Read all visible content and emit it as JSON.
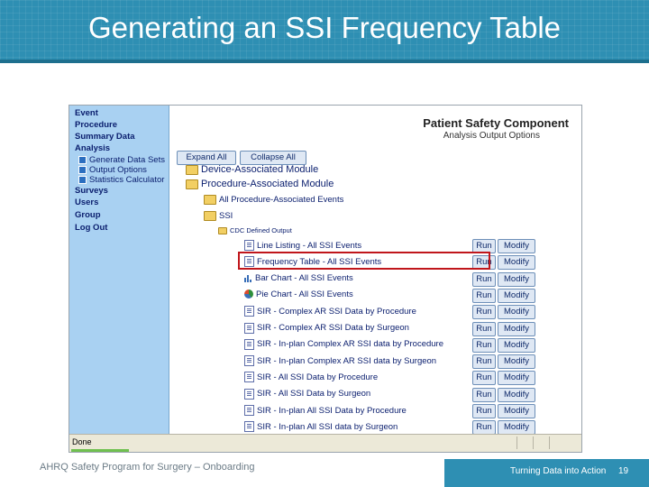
{
  "slide": {
    "title": "Generating an SSI Frequency Table",
    "footer_left": "AHRQ Safety Program for Surgery – Onboarding",
    "footer_right": "Turning Data into Action",
    "page_number": "19"
  },
  "nav": {
    "items": [
      "Event",
      "Procedure",
      "Summary Data",
      "Analysis"
    ],
    "analysis_sub": [
      "Generate Data Sets",
      "Output Options",
      "Statistics Calculator"
    ],
    "items_after": [
      "Surveys",
      "Users",
      "Group",
      "Log Out"
    ]
  },
  "component": {
    "title": "Patient Safety Component",
    "subtitle": "Analysis Output Options"
  },
  "tree": {
    "expand_all": "Expand All",
    "collapse_all": "Collapse All",
    "device_module": "Device-Associated Module",
    "procedure_module": "Procedure-Associated Module",
    "all_procedure_events": "All Procedure-Associated Events",
    "ssi": "SSI",
    "cdc_defined": "CDC Defined Output"
  },
  "rows": [
    {
      "label": "Line Listing - All SSI Events",
      "icon": "report-icon"
    },
    {
      "label": "Frequency Table - All SSI Events",
      "icon": "report-icon"
    },
    {
      "label": "Bar Chart - All SSI Events",
      "icon": "bar-chart-icon"
    },
    {
      "label": "Pie Chart - All SSI Events",
      "icon": "pie-chart-icon"
    },
    {
      "label": "SIR - Complex AR SSI Data by Procedure",
      "icon": "report-icon"
    },
    {
      "label": "SIR - Complex AR SSI Data by Surgeon",
      "icon": "report-icon"
    },
    {
      "label": "SIR - In-plan Complex AR SSI data by Procedure",
      "icon": "report-icon"
    },
    {
      "label": "SIR - In-plan Complex AR SSI data by Surgeon",
      "icon": "report-icon"
    },
    {
      "label": "SIR - All SSI Data by Procedure",
      "icon": "report-icon"
    },
    {
      "label": "SIR - All SSI Data by Surgeon",
      "icon": "report-icon"
    },
    {
      "label": "SIR - In-plan All SSI Data by Procedure",
      "icon": "report-icon"
    },
    {
      "label": "SIR - In-plan All SSI data by Surgeon",
      "icon": "report-icon"
    }
  ],
  "row_buttons": {
    "run": "Run",
    "modify": "Modify"
  },
  "status": {
    "text": "Done"
  },
  "colors": {
    "header": "#2e8fb3",
    "highlight": "#c0161b",
    "nav_bg": "#a9d1f2"
  }
}
